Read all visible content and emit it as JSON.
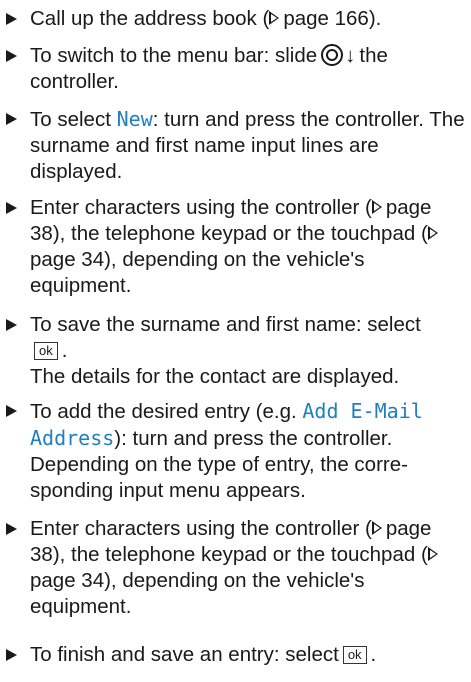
{
  "steps": [
    {
      "text_a": "Call up the address book (",
      "ref": "page 166",
      "text_b": ")."
    },
    {
      "text_a": "To switch to the menu bar: slide",
      "arrow": "↓",
      "text_b": "the controller."
    },
    {
      "text_a": "To select ",
      "display": "New",
      "text_b": ": turn and press the controller. The surname and first name input lines are displayed."
    },
    {
      "text_a": "Enter characters using the controller (",
      "ref1": "page 38",
      "text_b": "), the telephone keypad or the touchpad (",
      "ref2": "page 34",
      "text_c": "), depending on the vehicle's equipment."
    },
    {
      "text_a": "To save the surname and first name: select",
      "ok": "ok",
      "text_b": ".",
      "result": "The details for the contact are displayed."
    },
    {
      "text_a": "To add the desired entry (e.g. ",
      "display": "Add E-Mail Address",
      "text_b": "): turn and press the controller. Depending on the type of entry, the corre-sponding input menu appears."
    },
    {
      "text_a": "Enter characters using the controller (",
      "ref1": "page 38",
      "text_b": "), the telephone keypad or the touchpad (",
      "ref2": "page 34",
      "text_c": "), depending on the vehicle's equipment."
    },
    {
      "text_a": "To finish and save an entry: select",
      "ok": "ok",
      "text_b": "."
    }
  ],
  "icons": {
    "bullet": "triangle-bullet-icon",
    "reference": "page-reference-arrow-icon",
    "controller": "controller-icon"
  },
  "colors": {
    "display_text": "#1f7fbf",
    "text": "#1a1a1a"
  }
}
